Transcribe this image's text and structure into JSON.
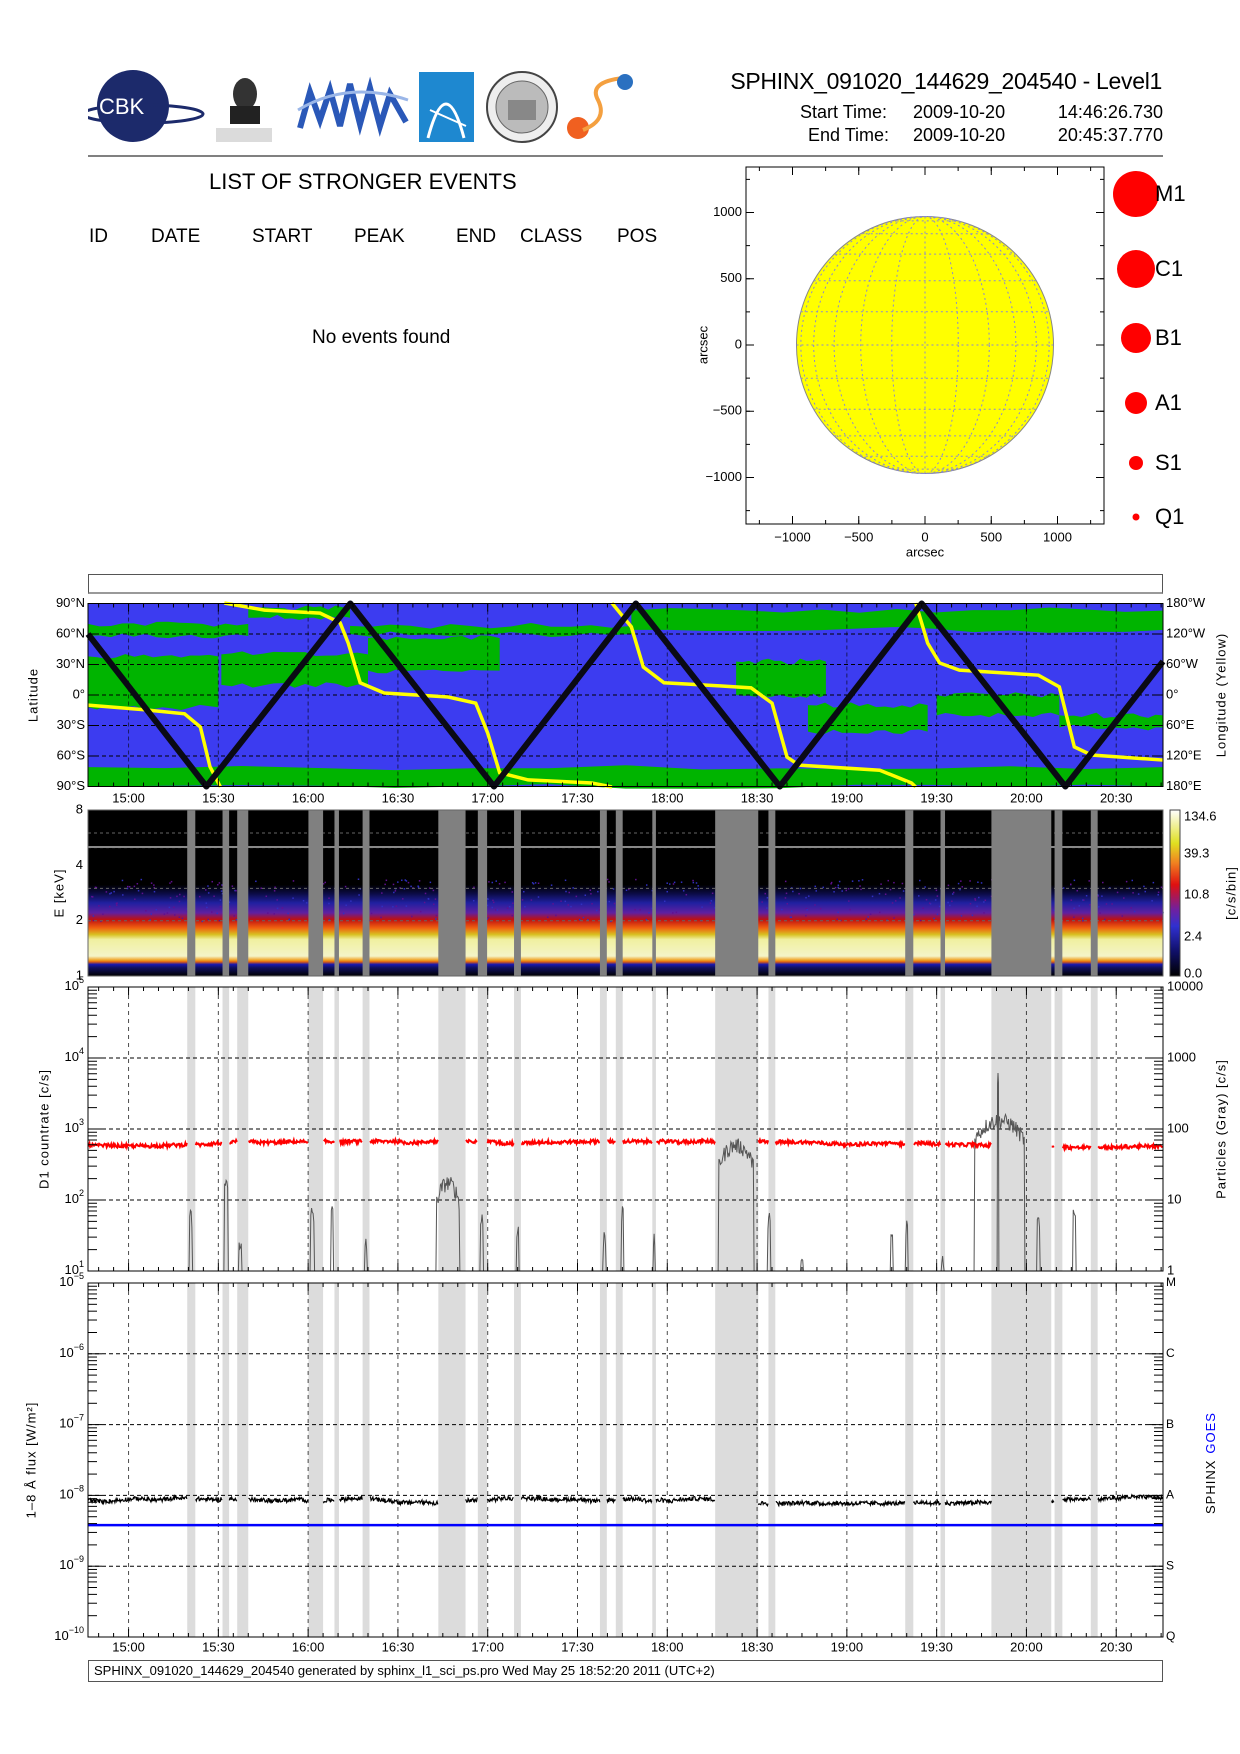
{
  "header": {
    "title": "SPHINX_091020_144629_204540 - Level1",
    "start_label": "Start Time:",
    "start_date": "2009-10-20",
    "start_time": "14:46:26.730",
    "end_label": "End Time:",
    "end_date": "2009-10-20",
    "end_time": "20:45:37.770",
    "logos": [
      "CBK PAN",
      "P.N.Lebedev Physical Institute of the Russian Academy of Science",
      "MIFI",
      "Specola Vaticana",
      "SphinX"
    ]
  },
  "events": {
    "title": "LIST OF STRONGER EVENTS",
    "columns": [
      "ID",
      "DATE",
      "START",
      "PEAK",
      "END",
      "CLASS",
      "POS"
    ],
    "empty_message": "No events found"
  },
  "footer": {
    "text": "SPHINX_091020_144629_204540 generated by sphinx_l1_sci_ps.pro Wed May 25 18:52:20 2011 (UTC+2)"
  },
  "colors": {
    "sun": "#ffff00",
    "flare": "#ff0000",
    "saa_blue": "#3c3cf0",
    "particle_green": "#00b400",
    "goes": "#0000ff",
    "gap_dark": "#808080",
    "gap_light": "#dcdcdc"
  },
  "chart_data": [
    {
      "type": "scatter",
      "name": "solar-disk-map",
      "xlabel": "arcsec",
      "ylabel": "arcsec",
      "xlim": [
        -1350,
        1350
      ],
      "ylim": [
        -1350,
        1350
      ],
      "xticks": [
        "−1000",
        "−500",
        "0",
        "500",
        "1000"
      ],
      "xtick_values": [
        -1000,
        -500,
        0,
        500,
        1000
      ],
      "yticks": [
        "1000",
        "500",
        "0",
        "−500",
        "−1000"
      ],
      "ytick_values": [
        1000,
        500,
        0,
        -500,
        -1000
      ],
      "solar_radius_arcsec": 970,
      "points": [],
      "legend": [
        "M1",
        "C1",
        "B1",
        "A1",
        "S1",
        "Q1"
      ],
      "legend_placement": "right"
    },
    {
      "type": "line",
      "name": "orbit-map",
      "time_unit": "minutes after 15:00",
      "xlim": [
        -13.55,
        345.63
      ],
      "xticks": [
        "15:00",
        "15:30",
        "16:00",
        "16:30",
        "17:00",
        "17:30",
        "18:00",
        "18:30",
        "19:00",
        "19:30",
        "20:00",
        "20:30"
      ],
      "ylabel": "Latitude",
      "y2label": "Longitude (Yellow)",
      "yticks": [
        "90°N",
        "60°N",
        "30°N",
        "0°",
        "30°S",
        "60°S",
        "90°S"
      ],
      "y2ticks": [
        "180°W",
        "120°W",
        "60°W",
        "0°",
        "60°E",
        "120°E",
        "180°E"
      ],
      "ylim": [
        -90,
        90
      ],
      "latitude_track": [
        [
          -13.55,
          60
        ],
        [
          26,
          -90
        ],
        [
          74.1,
          90
        ],
        [
          122.1,
          -90
        ],
        [
          169.5,
          90
        ],
        [
          217.6,
          -90
        ],
        [
          265,
          90
        ],
        [
          313,
          -90
        ],
        [
          345.63,
          33
        ]
      ],
      "longitude_track_segments": [
        [
          [
            -13.55,
            -20
          ],
          [
            5.3,
            -29
          ],
          [
            18.7,
            -37
          ],
          [
            24,
            -63
          ],
          [
            27.2,
            -141
          ],
          [
            30.7,
            -181
          ]
        ],
        [
          [
            32,
            181
          ],
          [
            45.4,
            167
          ],
          [
            64,
            161
          ],
          [
            70.7,
            142
          ],
          [
            73.4,
            102
          ],
          [
            77.4,
            24
          ],
          [
            85.4,
            4
          ],
          [
            106.8,
            -4
          ],
          [
            116,
            -16
          ],
          [
            120,
            -75
          ],
          [
            124,
            -153
          ],
          [
            133.5,
            -167
          ],
          [
            154.8,
            -173
          ],
          [
            161.5,
            -181
          ]
        ],
        [
          [
            161.5,
            181
          ],
          [
            168,
            134
          ],
          [
            172,
            55
          ],
          [
            178.9,
            24
          ],
          [
            197.5,
            18
          ],
          [
            208,
            14
          ],
          [
            215,
            -16
          ],
          [
            220,
            -122
          ],
          [
            224,
            -138
          ],
          [
            251,
            -148
          ],
          [
            261.6,
            -173
          ],
          [
            263,
            -181
          ]
        ],
        [
          [
            263,
            181
          ],
          [
            267,
            102
          ],
          [
            271,
            63
          ],
          [
            277.6,
            49
          ],
          [
            304,
            39
          ],
          [
            311,
            16
          ],
          [
            316,
            -102
          ],
          [
            321.7,
            -118
          ],
          [
            345.63,
            -128
          ]
        ]
      ],
      "particle_regions": [
        [
          -13.55,
          345.63,
          -90,
          -71
        ],
        [
          -13.55,
          40,
          58,
          70
        ],
        [
          40,
          74,
          76,
          85
        ],
        [
          74,
          168,
          60,
          68
        ],
        [
          168,
          345.63,
          64,
          83
        ],
        [
          -13.55,
          30,
          -12,
          38
        ],
        [
          31,
          80,
          10,
          40
        ],
        [
          80,
          124,
          24,
          56
        ],
        [
          203,
          233,
          0,
          33
        ],
        [
          227,
          267,
          -36,
          -10
        ],
        [
          270,
          311,
          -20,
          0
        ],
        [
          311,
          345.63,
          -32,
          -20
        ]
      ]
    },
    {
      "type": "heatmap",
      "name": "spectrogram",
      "ylabel": "E [keV]",
      "yticks": [
        "1",
        "2",
        "4",
        "8"
      ],
      "ytick_values": [
        1,
        2,
        4,
        8
      ],
      "ylim": [
        1,
        8
      ],
      "colorbar_label": "[c/s/bin]",
      "colorbar_ticks": [
        "0.0",
        "2.4",
        "10.8",
        "39.3",
        "134.6"
      ]
    },
    {
      "type": "line",
      "name": "countrate",
      "ylabel": "D1 countrate [c/s]",
      "y2label": "Particles (Gray) [c/s]",
      "ylim": [
        10,
        100000
      ],
      "yticks": [
        {
          "base": "10",
          "exp": "1"
        },
        {
          "base": "10",
          "exp": "2"
        },
        {
          "base": "10",
          "exp": "3"
        },
        {
          "base": "10",
          "exp": "4"
        },
        {
          "base": "10",
          "exp": "5"
        }
      ],
      "y2ticks": [
        "1",
        "10",
        "100",
        "1000",
        "10000"
      ],
      "d1_level_cps": 600,
      "particle_bursts": [
        [
          20.8,
          7.6,
          1.2
        ],
        [
          32.6,
          24,
          1.5
        ],
        [
          37.3,
          3.4,
          1.2
        ],
        [
          61.4,
          10,
          1.5
        ],
        [
          68,
          9.5,
          1
        ],
        [
          79.3,
          3.4,
          1
        ],
        [
          106.7,
          22,
          8
        ],
        [
          118,
          7.3,
          1.2
        ],
        [
          130,
          5.5,
          1
        ],
        [
          155,
          1.4,
          0.8
        ],
        [
          159,
          4.2,
          1.2
        ],
        [
          165,
          8.8,
          1
        ],
        [
          175.6,
          4,
          0.8
        ],
        [
          203,
          74,
          12
        ],
        [
          214,
          7.6,
          1.2
        ],
        [
          225,
          1.9,
          1
        ],
        [
          255,
          4.2,
          1
        ],
        [
          260,
          5.5,
          1
        ],
        [
          272,
          1.9,
          1
        ],
        [
          291,
          167,
          17
        ],
        [
          290.5,
          617,
          0.6
        ],
        [
          304,
          8.1,
          1.2
        ],
        [
          316,
          10,
          1.2
        ]
      ]
    },
    {
      "type": "line",
      "name": "goes-flux",
      "ylabel": "1–8 Å flux [W/m²]",
      "ylim": [
        1e-10,
        1e-05
      ],
      "yticks": [
        {
          "base": "10",
          "exp": "−10"
        },
        {
          "base": "10",
          "exp": "−9"
        },
        {
          "base": "10",
          "exp": "−8"
        },
        {
          "base": "10",
          "exp": "−7"
        },
        {
          "base": "10",
          "exp": "−6"
        },
        {
          "base": "10",
          "exp": "−5"
        }
      ],
      "y2ticks": [
        "Q",
        "S",
        "A",
        "B",
        "C",
        "M"
      ],
      "legend": [
        "SPHINX",
        "GOES"
      ],
      "legend_placement": "right",
      "series": [
        {
          "name": "SPHINX",
          "level_w_m2": 8.6e-09,
          "color": "#000000"
        },
        {
          "name": "GOES",
          "level_w_m2": 3.8e-09,
          "color": "#0000ff"
        }
      ]
    }
  ],
  "data_gaps": [
    [
      19.6,
      22.3
    ],
    [
      31.4,
      33.6
    ],
    [
      36.3,
      40.0
    ],
    [
      60.1,
      65.0
    ],
    [
      68.8,
      70.3
    ],
    [
      78.2,
      80.5
    ],
    [
      103.5,
      112.6
    ],
    [
      116.7,
      119.8
    ],
    [
      128.8,
      131.1
    ],
    [
      157.5,
      159.8
    ],
    [
      162.8,
      165.1
    ],
    [
      175,
      176.2
    ],
    [
      196,
      210.4
    ],
    [
      213.8,
      216.1
    ],
    [
      259.5,
      262.2
    ],
    [
      271.3,
      272.8
    ],
    [
      288.3,
      308.3
    ],
    [
      309.4,
      312
    ],
    [
      321.5,
      323.8
    ]
  ]
}
